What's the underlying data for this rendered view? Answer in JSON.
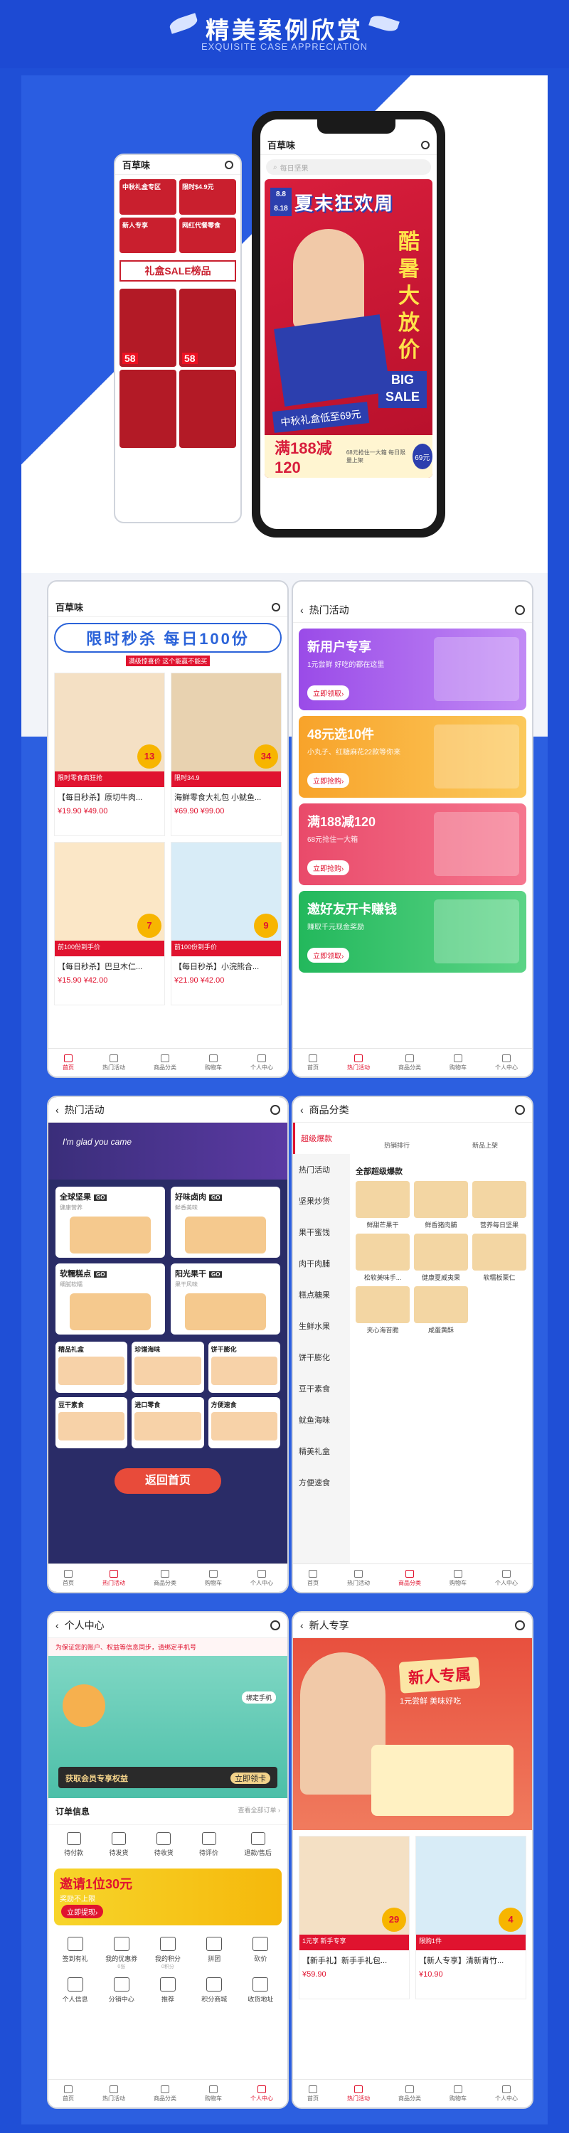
{
  "header": {
    "title": "精美案例欣赏",
    "subtitle": "EXQUISITE CASE APPRECIATION"
  },
  "hero": {
    "app_name": "百草味",
    "search_placeholder": "每日坚果",
    "banner_title": "夏末狂欢周",
    "banner_date_1": "8.8",
    "banner_date_2": "8.18",
    "banner_side": "酷暑大放价",
    "banner_sale": "BIG SALE",
    "banner_strip": "中秋礼盒低至69元",
    "banner_bottom": "满188减120",
    "banner_bottom_note": "68元抢住一大箱 每日限量上架",
    "banner_badge": "69元",
    "small_items": [
      "中秋礼盒专区",
      "限时$4.9元",
      "新人专享",
      "网红代餐零食"
    ],
    "small_banner": "礼盒SALE榜品",
    "small_prices": [
      "58",
      "58"
    ]
  },
  "tabs": {
    "home": "首页",
    "hot": "热门活动",
    "cat": "商品分类",
    "cart": "购物车",
    "me": "个人中心"
  },
  "p1": {
    "app": "百草味",
    "flash": "限时秒杀 每日100份",
    "flash_note": "满级惊喜价 这个能赢不能买",
    "products": [
      {
        "name": "【每日秒杀】原切牛肉...",
        "tag": "限时零食疯狂抢",
        "price": "13",
        "sub": "¥19.90 ¥49.00"
      },
      {
        "name": "海鲜零食大礼包 小鱿鱼...",
        "tag": "限时34.9",
        "price": "34",
        "sub": "¥69.90 ¥99.00"
      },
      {
        "name": "【每日秒杀】巴旦木仁...",
        "tag": "前100份到手价",
        "price": "7",
        "sub": "¥15.90 ¥42.00"
      },
      {
        "name": "【每日秒杀】小浣熊合...",
        "tag": "前100份到手价",
        "price": "9",
        "sub": "¥21.90 ¥42.00"
      }
    ]
  },
  "p2": {
    "title": "热门活动",
    "cards": [
      {
        "t": "新用户专享",
        "s": "1元尝鲜 好吃的都在这里",
        "btn": "立即领取›"
      },
      {
        "t": "48元选10件",
        "s": "小丸子、红糖麻花22款等你来",
        "btn": "立即抢购›"
      },
      {
        "t": "满188减120",
        "s": "68元抢住一大箱",
        "btn": "立即抢购›"
      },
      {
        "t": "邀好友开卡赚钱",
        "s": "赚取千元现金奖励",
        "btn": "立即领取›"
      }
    ]
  },
  "p3": {
    "title": "热门活动",
    "head": "I'm glad you came",
    "cells": [
      {
        "t": "全球坚果",
        "note": "健康营养"
      },
      {
        "t": "好味卤肉",
        "note": "鲜香美味"
      },
      {
        "t": "软糯糕点",
        "note": "细腻软糯"
      },
      {
        "t": "阳光果干",
        "note": "果干风味"
      }
    ],
    "cells3": [
      "精品礼盒",
      "珍馐海味",
      "饼干膨化",
      "豆干素食",
      "进口零食",
      "方便速食"
    ],
    "back": "返回首页"
  },
  "p4": {
    "title": "商品分类",
    "side": [
      "超级爆款",
      "热门活动",
      "坚果炒货",
      "果干蜜饯",
      "肉干肉脯",
      "糕点糖果",
      "生鲜水果",
      "饼干膨化",
      "豆干素食",
      "鱿鱼海味",
      "精美礼盒",
      "方便速食"
    ],
    "head": [
      "热销排行",
      "新品上架"
    ],
    "h": "全部超级爆款",
    "items": [
      "鲜甜芒果干",
      "鲜香猪肉脯",
      "营养每日坚果",
      "松软美味手...",
      "健康夏威夷果",
      "软糯板栗仁",
      "夹心海苔脆",
      "咸蛋黄酥"
    ]
  },
  "p5": {
    "title": "个人中心",
    "tip": "为保证您的账户、权益等信息同步，请绑定手机号",
    "badge": "绑定手机",
    "vip": "获取会员专享权益",
    "vip_btn": "立即领卡",
    "order_h": "订单信息",
    "order_all": "查看全部订单 ›",
    "orders": [
      "待付款",
      "待发货",
      "待收货",
      "待评价",
      "退款/售后"
    ],
    "invite": "邀请1位30元",
    "invite_sub": "奖励不上限",
    "invite_btn": "立即提现›",
    "grid": [
      {
        "t": "签到有礼"
      },
      {
        "t": "我的优惠券",
        "s": "0张"
      },
      {
        "t": "我的积分",
        "s": "0积分"
      },
      {
        "t": "拼团"
      },
      {
        "t": "砍价"
      },
      {
        "t": "个人信息"
      },
      {
        "t": "分销中心"
      },
      {
        "t": "推荐"
      },
      {
        "t": "积分商城"
      },
      {
        "t": "收货地址"
      }
    ]
  },
  "p6": {
    "title": "新人专享",
    "banner_t": "新人专属",
    "banner_s": "1元尝鲜 美味好吃",
    "products": [
      {
        "name": "【新手礼】新手手礼包...",
        "tag": "1元享 新手专享",
        "price": "29",
        "sub": "¥59.90"
      },
      {
        "name": "【新人专享】清新青竹...",
        "tag": "限购1件",
        "price": "4",
        "sub": "¥10.90"
      }
    ]
  }
}
